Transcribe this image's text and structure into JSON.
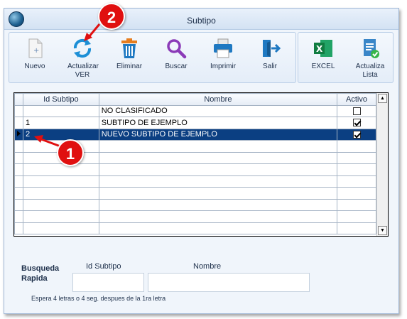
{
  "window": {
    "title": "Subtipo"
  },
  "toolbar": {
    "buttons": [
      {
        "label": "Nuevo",
        "icon": "new-document-icon"
      },
      {
        "label": "Actualizar VER",
        "icon": "refresh-icon"
      },
      {
        "label": "Eliminar",
        "icon": "trash-icon"
      },
      {
        "label": "Buscar",
        "icon": "search-icon"
      },
      {
        "label": "Imprimir",
        "icon": "printer-icon"
      },
      {
        "label": "Salir",
        "icon": "exit-icon"
      }
    ],
    "right_buttons": [
      {
        "label": "EXCEL",
        "icon": "excel-icon"
      },
      {
        "label": "Actualiza Lista",
        "icon": "update-list-icon"
      }
    ]
  },
  "grid": {
    "columns": [
      "Id Subtipo",
      "Nombre",
      "Activo"
    ],
    "rows": [
      {
        "id": "",
        "nombre": "NO CLASIFICADO",
        "activo": false,
        "selected": false
      },
      {
        "id": "1",
        "nombre": "SUBTIPO DE EJEMPLO",
        "activo": true,
        "selected": false
      },
      {
        "id": "2",
        "nombre": "NUEVO SUBTIPO DE EJEMPLO",
        "activo": true,
        "selected": true
      }
    ],
    "empty_rows": 8
  },
  "search": {
    "label": "Busqueda Rapida",
    "id_label": "Id Subtipo",
    "name_label": "Nombre",
    "id_value": "",
    "name_value": "",
    "hint": "Espera 4 letras o 4 seg. despues de la 1ra letra"
  },
  "annotations": {
    "badge1": "1",
    "badge2": "2",
    "color": "#e01010"
  }
}
